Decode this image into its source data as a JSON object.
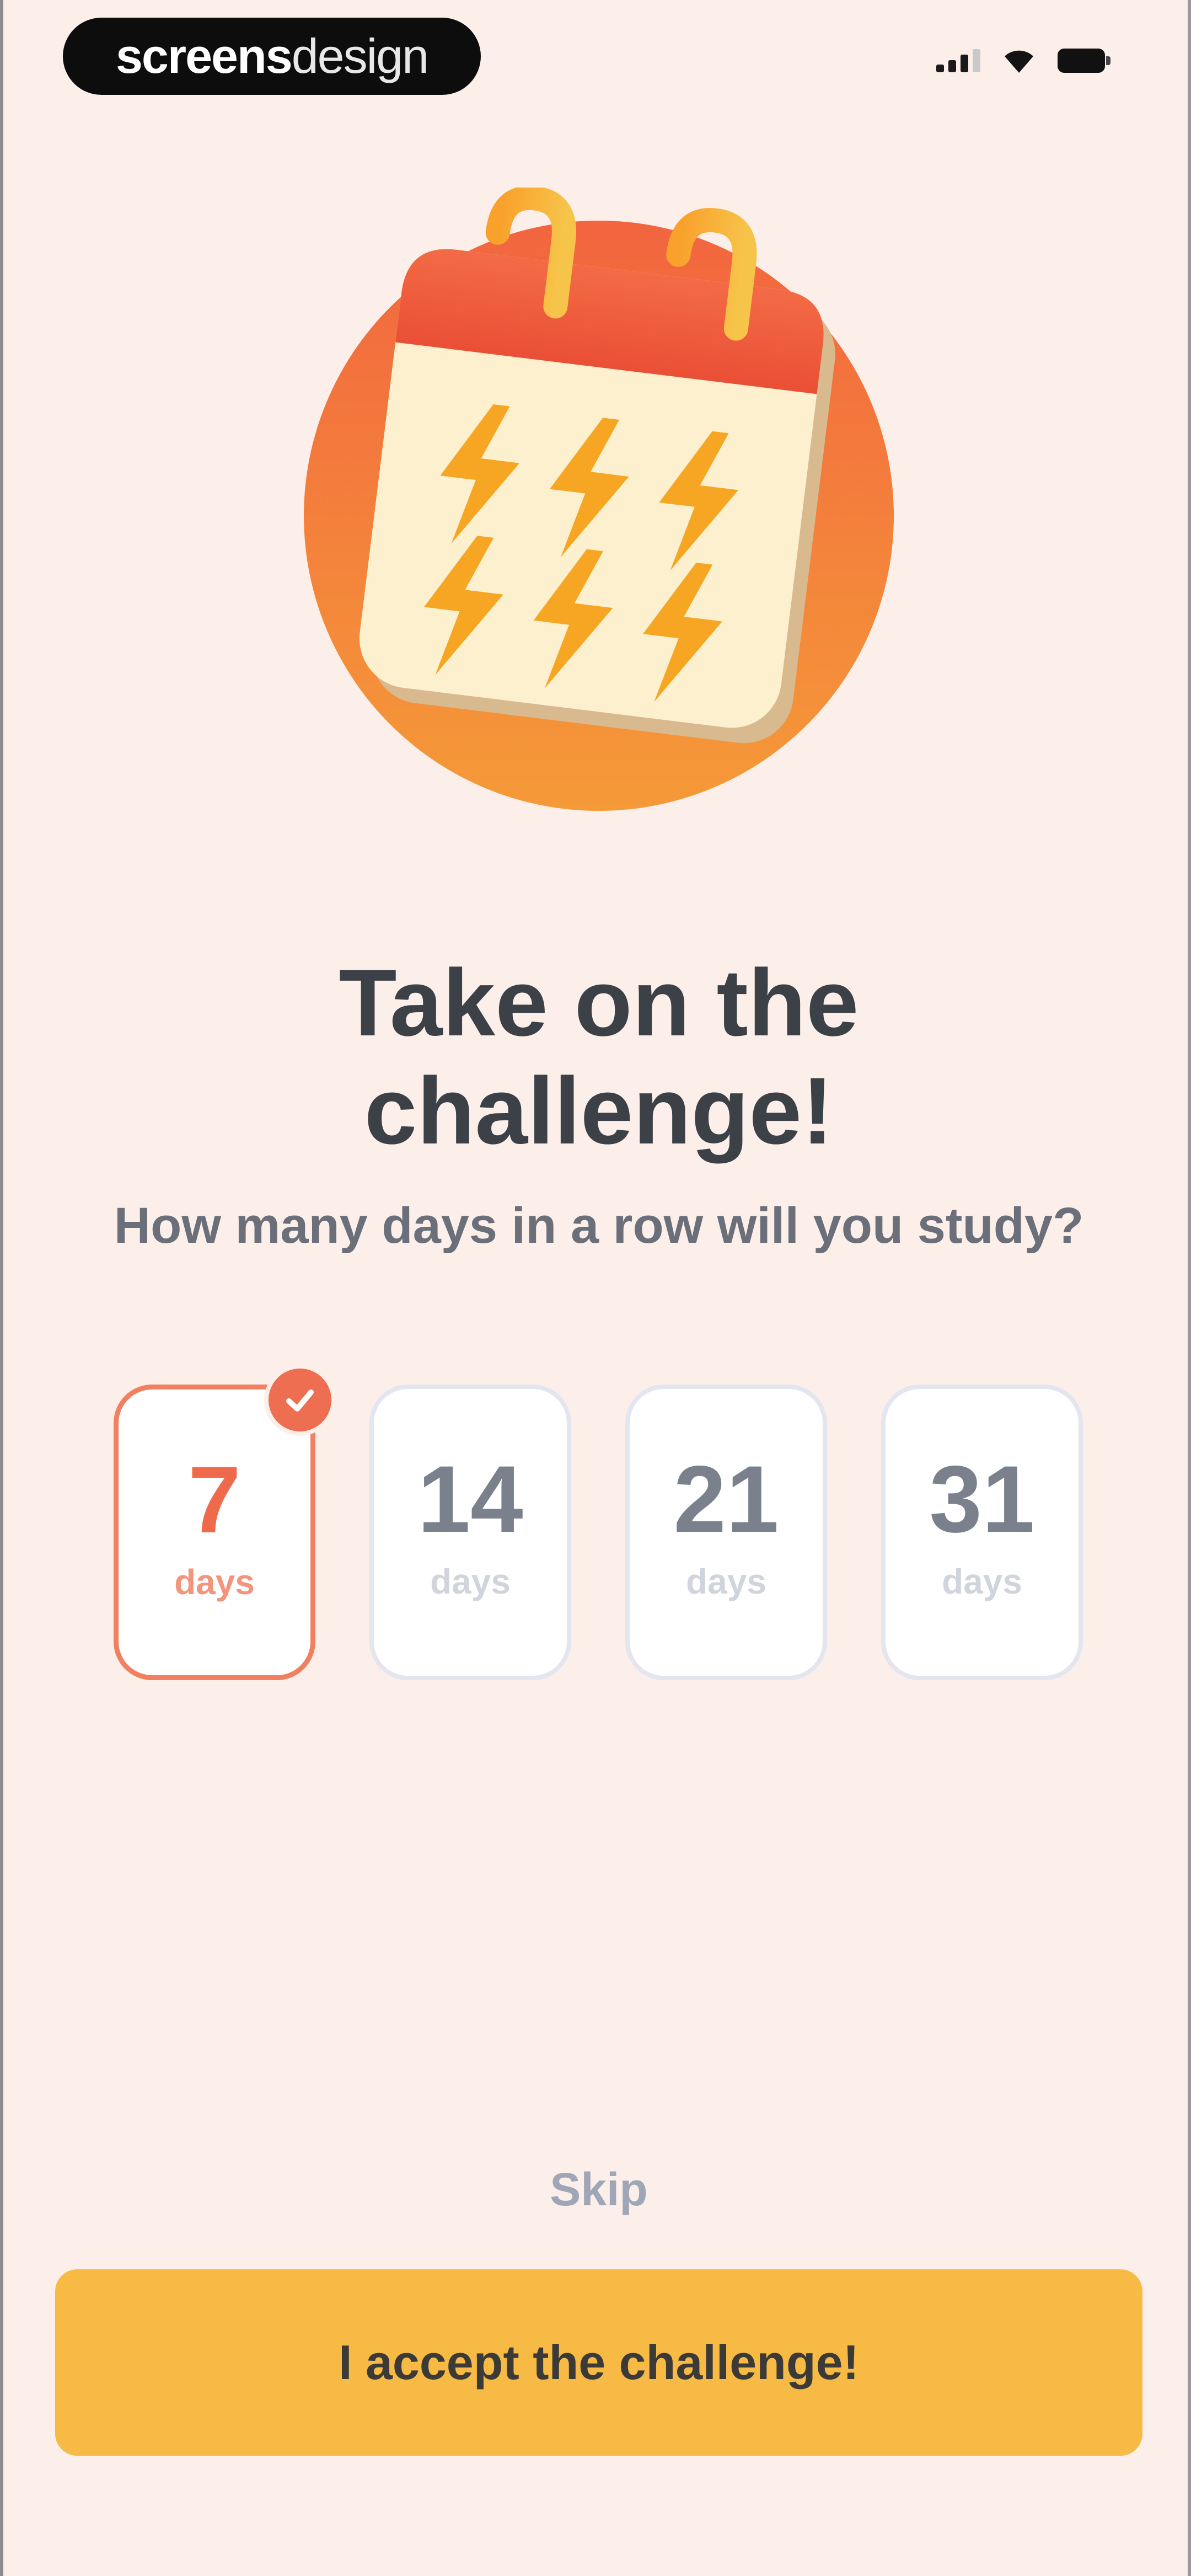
{
  "status_bar": {
    "brand_bold": "screens",
    "brand_light": "design"
  },
  "hero": {
    "icon": "calendar-lightning-icon",
    "colors": {
      "circle": "#f27a4a",
      "calendar_top": "#f0613f",
      "calendar_page": "#fdf0cf",
      "bolt": "#f6a623"
    }
  },
  "title": {
    "line1": "Take on the",
    "line2": "challenge!"
  },
  "subtitle": "How many days in a row will you study?",
  "options": [
    {
      "value": "7",
      "unit": "days",
      "selected": true
    },
    {
      "value": "14",
      "unit": "days",
      "selected": false
    },
    {
      "value": "21",
      "unit": "days",
      "selected": false
    },
    {
      "value": "31",
      "unit": "days",
      "selected": false
    }
  ],
  "actions": {
    "skip": "Skip",
    "accept": "I accept the challenge!"
  },
  "colors": {
    "background": "#fcefe9",
    "accent": "#ee6a4a",
    "button": "#f7bb45"
  }
}
